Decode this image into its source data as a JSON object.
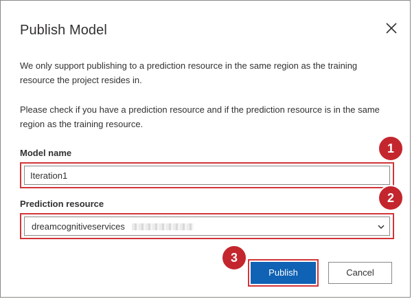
{
  "dialog": {
    "title": "Publish Model",
    "close_icon": "close-icon",
    "paragraph1": "We only support publishing to a prediction resource in the same region as the training resource the project resides in.",
    "paragraph2": "Please check if you have a prediction resource and if the prediction resource is in the same region as the training resource."
  },
  "form": {
    "model_name_label": "Model name",
    "model_name_value": "Iteration1",
    "prediction_resource_label": "Prediction resource",
    "prediction_resource_value": "dreamcognitiveservices"
  },
  "buttons": {
    "publish_label": "Publish",
    "cancel_label": "Cancel"
  },
  "callouts": {
    "step1": "1",
    "step2": "2",
    "step3": "3"
  },
  "colors": {
    "accent": "#0f62b4",
    "highlight": "#d13438",
    "badge": "#c4262e"
  }
}
